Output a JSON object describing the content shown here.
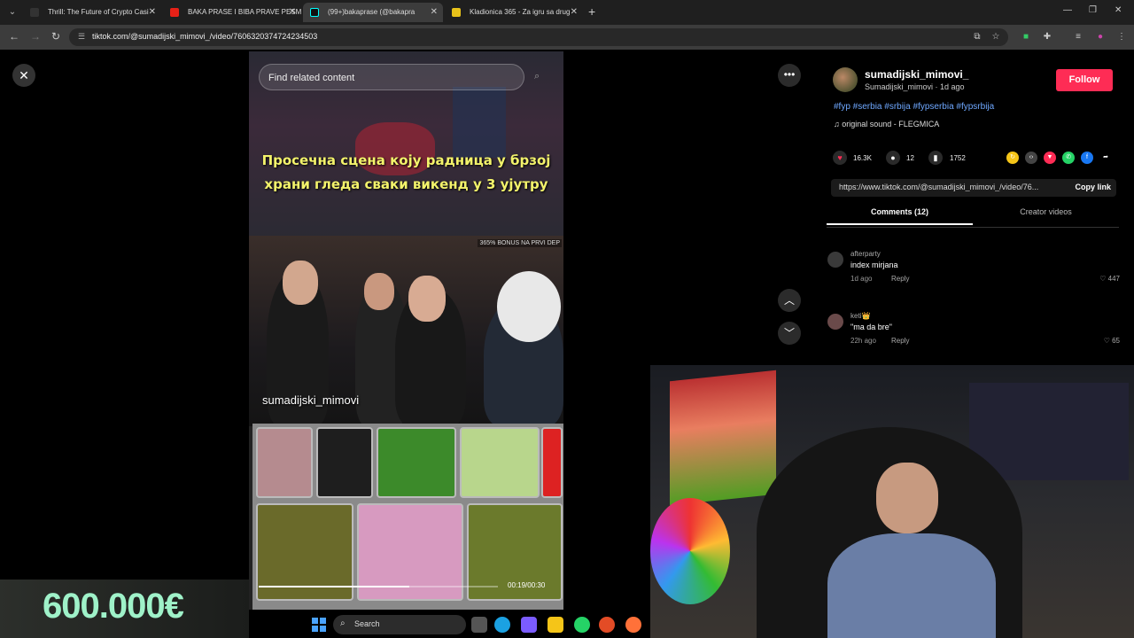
{
  "browser": {
    "tabs": [
      {
        "title": "Thrill: The Future of Crypto Casi",
        "fav_color": "#1e1e1e"
      },
      {
        "title": "BAKA PRASE I BIBA PRAVE PESM",
        "fav_color": "#e62117"
      },
      {
        "title": "(99+)bakaprase (@bakapra",
        "fav_color": "#111111"
      },
      {
        "title": "Kladionica 365 - Za igru sa drug",
        "fav_color": "#e8c21a"
      }
    ],
    "url": "tiktok.com/@sumadijski_mimovi_/video/7606320374724234503"
  },
  "video": {
    "search_placeholder": "Find related content",
    "caption_line1": "Просечна сцена коју радница у брзој",
    "caption_line2": "храни гледа сваки викенд у 3 ујутру",
    "corner_badge": "365% BONUS NA PRVI DEP",
    "handle": "sumadijski_mimovi",
    "timecode": "00:19/00:30",
    "progress": 0.63
  },
  "post": {
    "username": "sumadijski_mimovi_",
    "subline": "Sumadijski_mimovi · 1d ago",
    "follow_label": "Follow",
    "hashtags": "#fyp #serbia #srbija #fypserbia #fypsrbija",
    "sound": "original sound - FLEGMICA",
    "likes": "16.3K",
    "comments": "12",
    "saves": "1752",
    "link": "https://www.tiktok.com/@sumadijski_mimovi_/video/76...",
    "copy_link_label": "Copy link",
    "tab_comments": "Comments (12)",
    "tab_creator": "Creator videos"
  },
  "comments": [
    {
      "user": "afterparty",
      "text": "index mirjana",
      "time": "1d ago",
      "reply": "Reply",
      "likes": "447"
    },
    {
      "user": "keti👑",
      "text": "\"ma da bre\"",
      "time": "22h ago",
      "reply": "Reply",
      "likes": "65"
    }
  ],
  "overlay": {
    "money": "600.000€"
  },
  "taskbar": {
    "search_label": "Search"
  },
  "colors": {
    "follow": "#fe2c55",
    "hashtag": "#6fa8ff",
    "caption": "#f3f36b",
    "money": "#9ff2c9"
  }
}
